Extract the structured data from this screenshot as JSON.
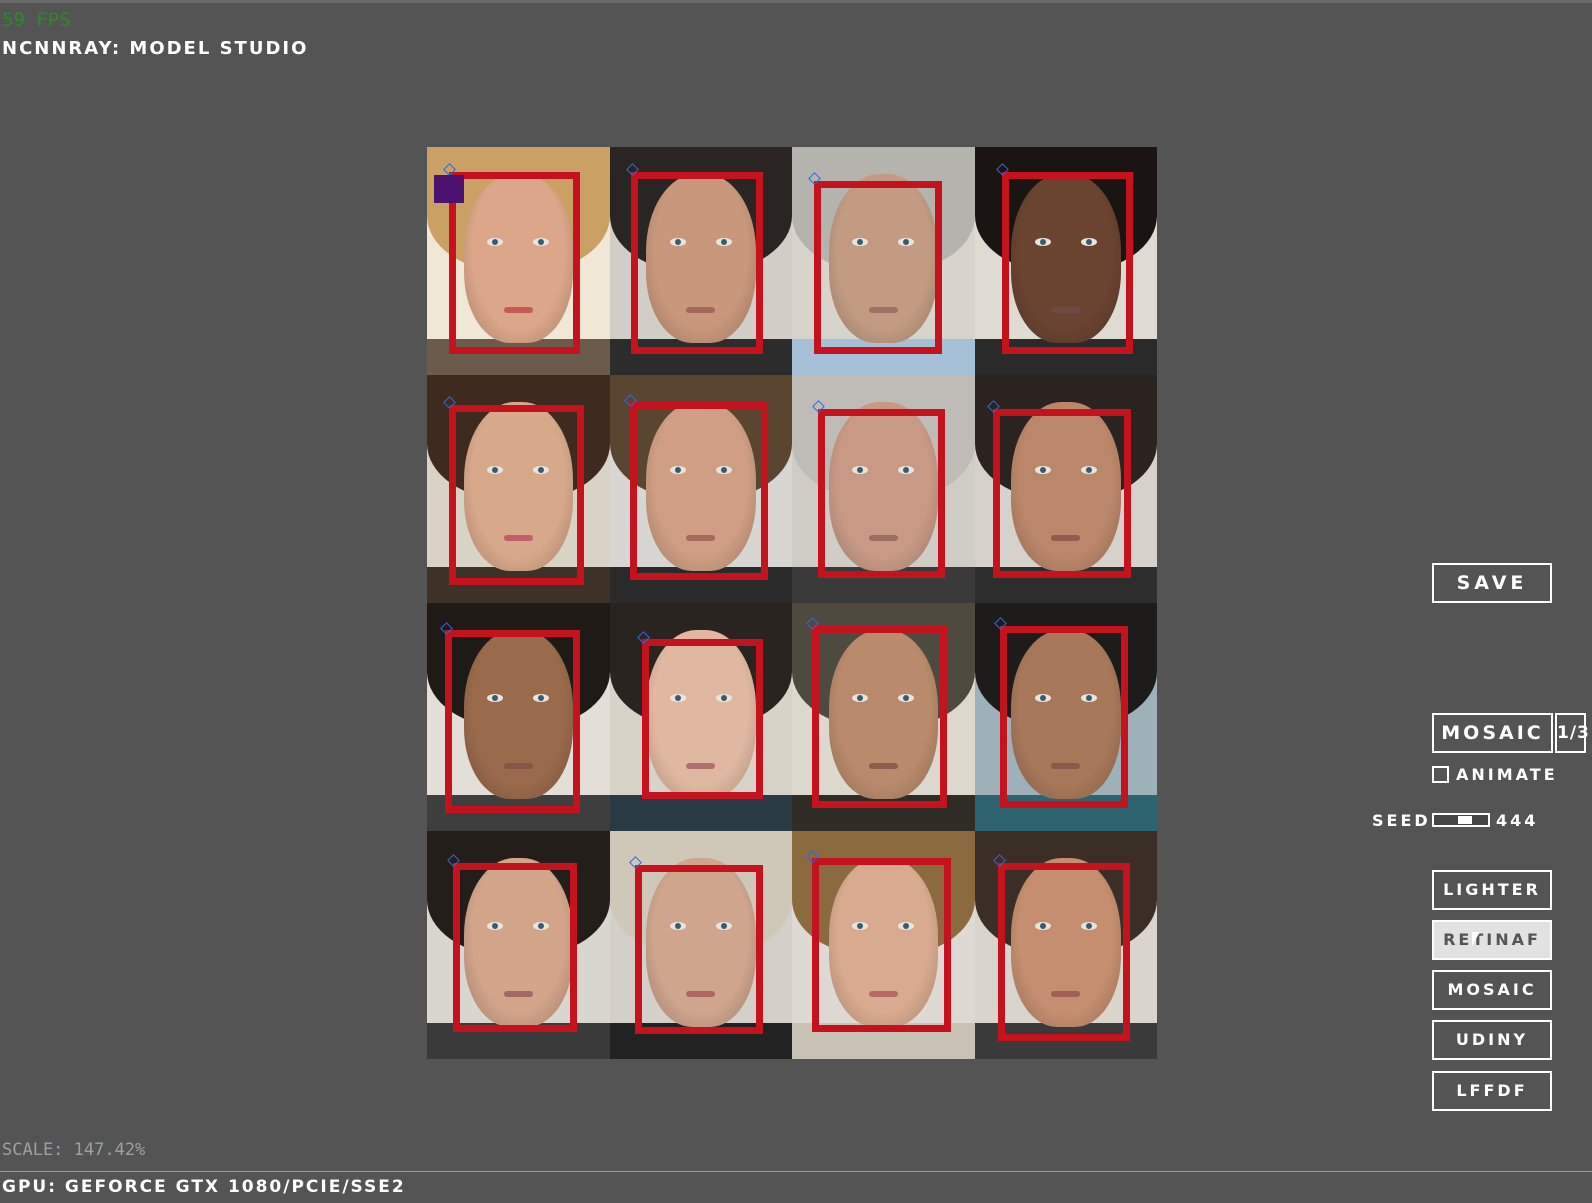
{
  "header": {
    "fps": "59 FPS",
    "title": "NCNNRAY: MODEL STUDIO"
  },
  "mosaic": {
    "rows": 4,
    "columns": 4,
    "tiles": [
      {
        "skin": "#dba689",
        "hair": "#caa064",
        "bg": "#f1e7d6",
        "lips": "#c75a55",
        "shirt": "#6b5b4a",
        "top_mark": true
      },
      {
        "skin": "#c8977c",
        "hair": "#2a2522",
        "bg": "#d2cdc6",
        "lips": "#a5685c",
        "shirt": "#2c2c2c"
      },
      {
        "skin": "#c29b82",
        "hair": "#b5b3ae",
        "bg": "#d8d4cc",
        "lips": "#a07264",
        "shirt": "#a6c0d8"
      },
      {
        "skin": "#6a4331",
        "hair": "#1a1512",
        "bg": "#dfdbd3",
        "lips": "#6e4a46",
        "shirt": "#2a2a2a"
      },
      {
        "skin": "#d8a88a",
        "hair": "#3e2a1f",
        "bg": "#d9d3c6",
        "lips": "#c1606a",
        "shirt": "#3d3128"
      },
      {
        "skin": "#cf9e84",
        "hair": "#5a4530",
        "bg": "#d8d6d2",
        "lips": "#a06a5c",
        "shirt": "#2a2a2a"
      },
      {
        "skin": "#c89a86",
        "hair": "#bfbcb7",
        "bg": "#d0ccc6",
        "lips": "#9c6e62",
        "shirt": "#3a3a3a"
      },
      {
        "skin": "#bb876a",
        "hair": "#2a2320",
        "bg": "#d6d2cb",
        "lips": "#915b4f",
        "shirt": "#2d2d2d"
      },
      {
        "skin": "#9a6a4c",
        "hair": "#201a17",
        "bg": "#e3dfd8",
        "lips": "#8a5446",
        "shirt": "#3e3e3e"
      },
      {
        "skin": "#e0b8a1",
        "hair": "#2a2420",
        "bg": "#d8d3c9",
        "lips": "#b07070",
        "shirt": "#2a3a44"
      },
      {
        "skin": "#b98a6c",
        "hair": "#4f4a3f",
        "bg": "#dcd8cd",
        "lips": "#8f5d4f",
        "shirt": "#2f2b25"
      },
      {
        "skin": "#a8785a",
        "hair": "#1e1c1a",
        "bg": "#9eb1b9",
        "lips": "#8a5a4c",
        "shirt": "#2d6470"
      },
      {
        "skin": "#d2a48a",
        "hair": "#241e1a",
        "bg": "#d9d6cf",
        "lips": "#a06a62",
        "shirt": "#3a3a3a"
      },
      {
        "skin": "#cfa58e",
        "hair": "#cfc8b9",
        "bg": "#d4d0c9",
        "lips": "#b06764",
        "shirt": "#222222"
      },
      {
        "skin": "#d8aa8f",
        "hair": "#8a6a3e",
        "bg": "#dedad3",
        "lips": "#b86a67",
        "shirt": "#c9c3b6"
      },
      {
        "skin": "#c58e70",
        "hair": "#3a2e26",
        "bg": "#d9d4cc",
        "lips": "#a06054",
        "shirt": "#3a3a3a"
      }
    ]
  },
  "panel": {
    "save_label": "SAVE",
    "mosaic_label": "MOSAIC",
    "page_label": "1/3",
    "animate_label": "ANIMATE",
    "animate_checked": false,
    "seed_label": "SEED",
    "seed_value": "444",
    "seed_slider_fraction": 0.6,
    "models": [
      {
        "label": "LIGHTER",
        "active": false
      },
      {
        "label": "RETINAF",
        "active": true
      },
      {
        "label": "MOSAIC",
        "active": false
      },
      {
        "label": "UDINY",
        "active": false
      },
      {
        "label": "LFFDF",
        "active": false
      }
    ]
  },
  "footer": {
    "scale": "SCALE: 147.42%",
    "gpu": "GPU: GEFORCE GTX 1080/PCIE/SSE2"
  },
  "colors": {
    "background": "#545454",
    "bbox": "#c4121e",
    "keypoint": "#2d6ae0",
    "fps": "#2a8a2a"
  }
}
